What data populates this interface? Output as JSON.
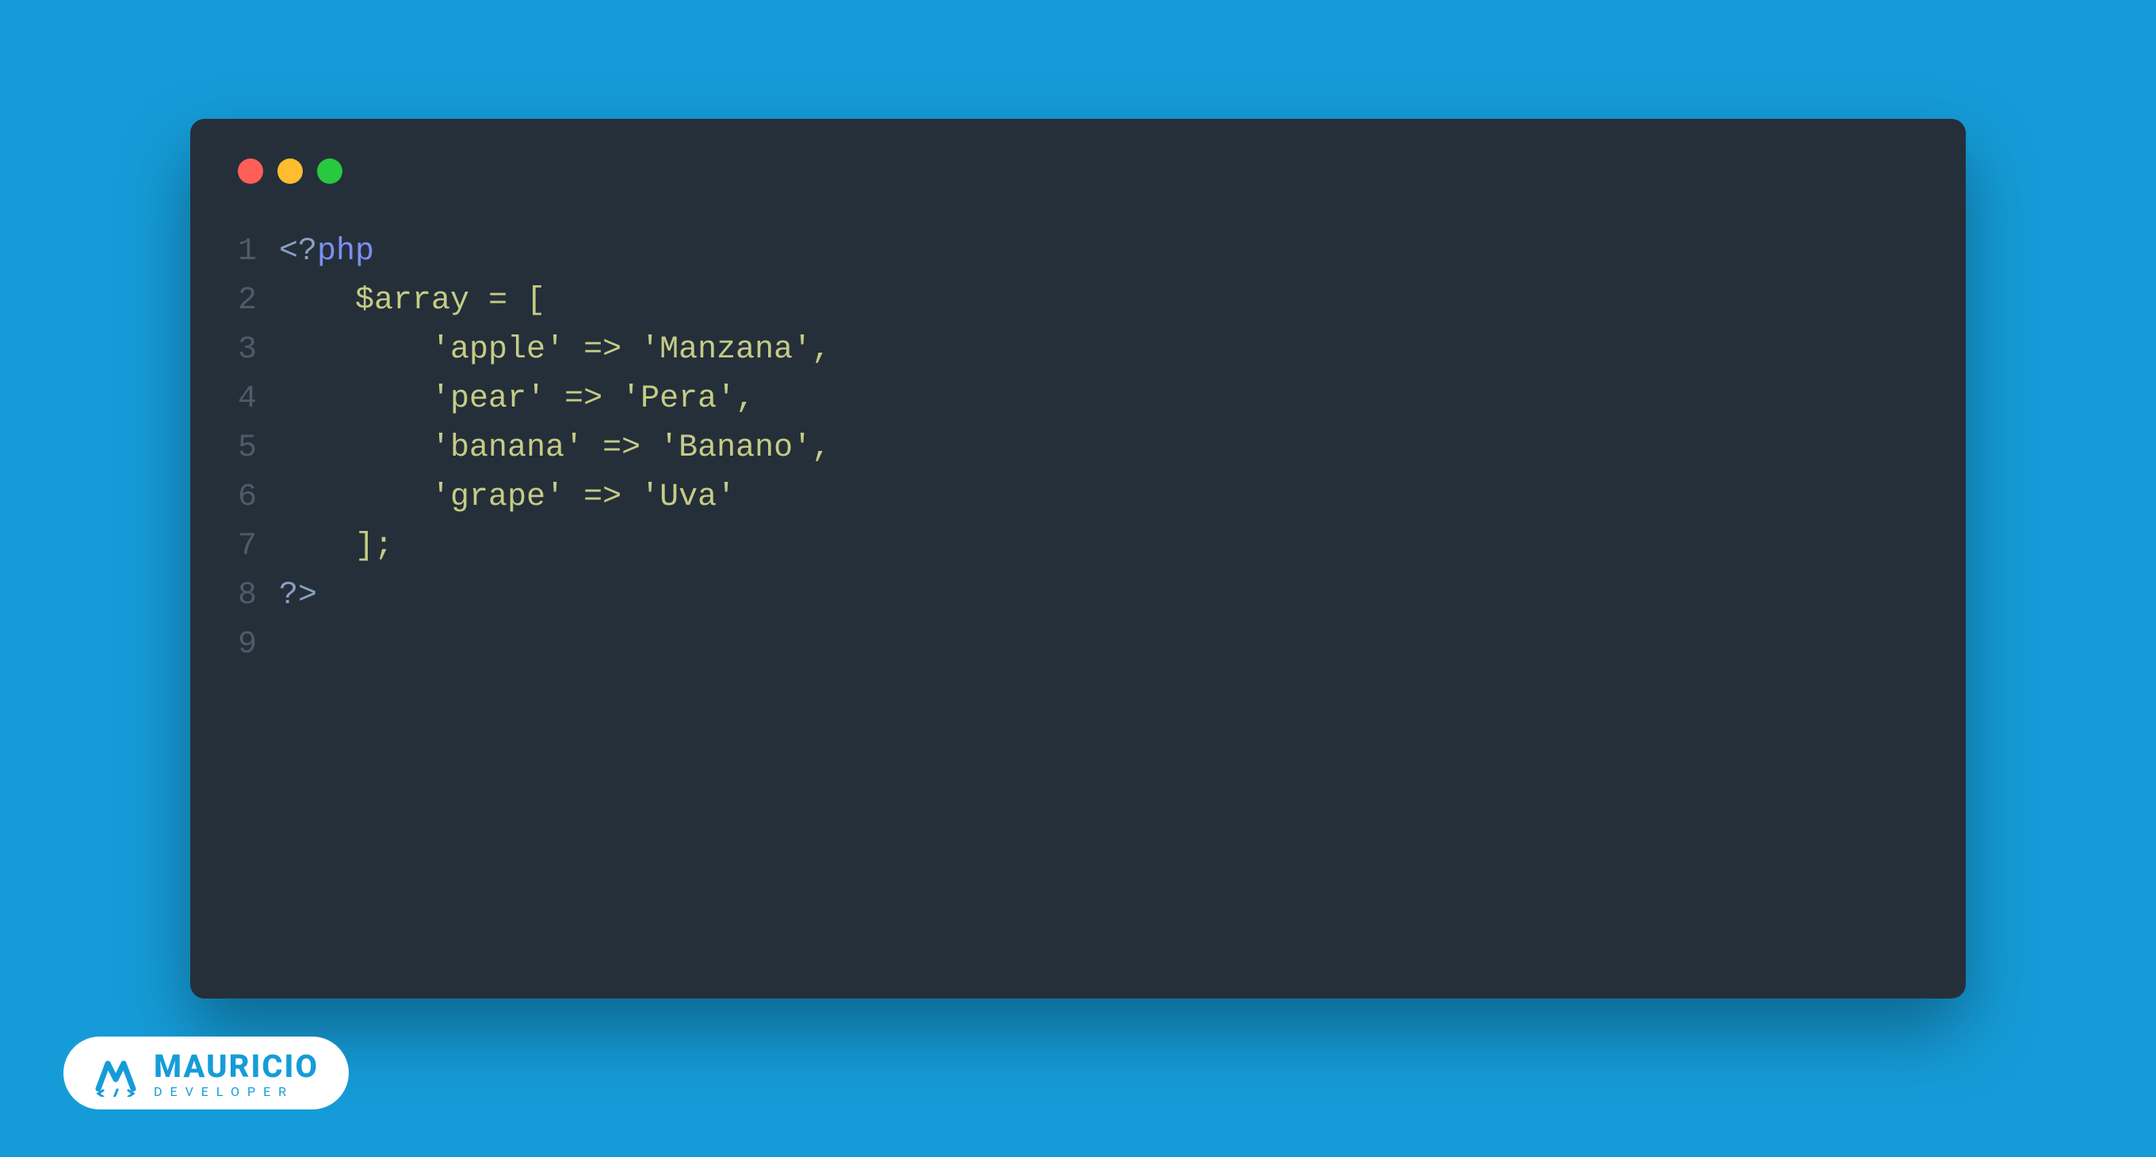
{
  "window": {
    "dots": {
      "red": "#ff5f57",
      "yellow": "#febc2e",
      "green": "#28c840"
    }
  },
  "code": {
    "language": "php",
    "lines": [
      {
        "n": "1",
        "tokens": [
          {
            "cls": "tok-tag",
            "t": "<?"
          },
          {
            "cls": "tok-keyword",
            "t": "php"
          }
        ]
      },
      {
        "n": "2",
        "tokens": [
          {
            "cls": "tok-default",
            "t": "    "
          },
          {
            "cls": "tok-variable",
            "t": "$array"
          },
          {
            "cls": "tok-default",
            "t": " "
          },
          {
            "cls": "tok-operator",
            "t": "="
          },
          {
            "cls": "tok-default",
            "t": " "
          },
          {
            "cls": "tok-operator",
            "t": "["
          }
        ]
      },
      {
        "n": "3",
        "tokens": [
          {
            "cls": "tok-default",
            "t": "        "
          },
          {
            "cls": "tok-string",
            "t": "'apple'"
          },
          {
            "cls": "tok-default",
            "t": " "
          },
          {
            "cls": "tok-operator",
            "t": "=>"
          },
          {
            "cls": "tok-default",
            "t": " "
          },
          {
            "cls": "tok-string",
            "t": "'Manzana'"
          },
          {
            "cls": "tok-operator",
            "t": ","
          }
        ]
      },
      {
        "n": "4",
        "tokens": [
          {
            "cls": "tok-default",
            "t": "        "
          },
          {
            "cls": "tok-string",
            "t": "'pear'"
          },
          {
            "cls": "tok-default",
            "t": " "
          },
          {
            "cls": "tok-operator",
            "t": "=>"
          },
          {
            "cls": "tok-default",
            "t": " "
          },
          {
            "cls": "tok-string",
            "t": "'Pera'"
          },
          {
            "cls": "tok-operator",
            "t": ","
          }
        ]
      },
      {
        "n": "5",
        "tokens": [
          {
            "cls": "tok-default",
            "t": "        "
          },
          {
            "cls": "tok-string",
            "t": "'banana'"
          },
          {
            "cls": "tok-default",
            "t": " "
          },
          {
            "cls": "tok-operator",
            "t": "=>"
          },
          {
            "cls": "tok-default",
            "t": " "
          },
          {
            "cls": "tok-string",
            "t": "'Banano'"
          },
          {
            "cls": "tok-operator",
            "t": ","
          }
        ]
      },
      {
        "n": "6",
        "tokens": [
          {
            "cls": "tok-default",
            "t": "        "
          },
          {
            "cls": "tok-string",
            "t": "'grape'"
          },
          {
            "cls": "tok-default",
            "t": " "
          },
          {
            "cls": "tok-operator",
            "t": "=>"
          },
          {
            "cls": "tok-default",
            "t": " "
          },
          {
            "cls": "tok-string",
            "t": "'Uva'"
          }
        ]
      },
      {
        "n": "7",
        "tokens": [
          {
            "cls": "tok-default",
            "t": "    "
          },
          {
            "cls": "tok-operator",
            "t": "];"
          }
        ]
      },
      {
        "n": "8",
        "tokens": [
          {
            "cls": "tok-tag",
            "t": "?>"
          }
        ]
      },
      {
        "n": "9",
        "tokens": []
      }
    ]
  },
  "brand": {
    "name": "MAURICIO",
    "subtitle": "DEVELOPER"
  }
}
